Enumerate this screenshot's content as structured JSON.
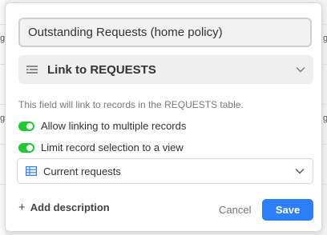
{
  "background": {
    "left_fragments": [
      "g",
      "g"
    ],
    "right_fragments": [
      "g",
      "g"
    ]
  },
  "field_editor": {
    "name_value": "Outstanding Requests (home policy)",
    "field_type": {
      "icon": "link-lines-icon",
      "label": "Link to REQUESTS"
    },
    "help_text": "This field will link to records in the REQUESTS table.",
    "options": [
      {
        "label": "Allow linking to multiple records",
        "enabled": true
      },
      {
        "label": "Limit record selection to a view",
        "enabled": true
      }
    ],
    "view_select": {
      "icon": "grid-view-icon",
      "label": "Current requests"
    },
    "add_description_label": "Add description",
    "cancel_label": "Cancel",
    "save_label": "Save"
  },
  "colors": {
    "toggle_on": "#20c933",
    "save_button": "#2d7ff9",
    "grid_icon": "#2d7ff9"
  }
}
